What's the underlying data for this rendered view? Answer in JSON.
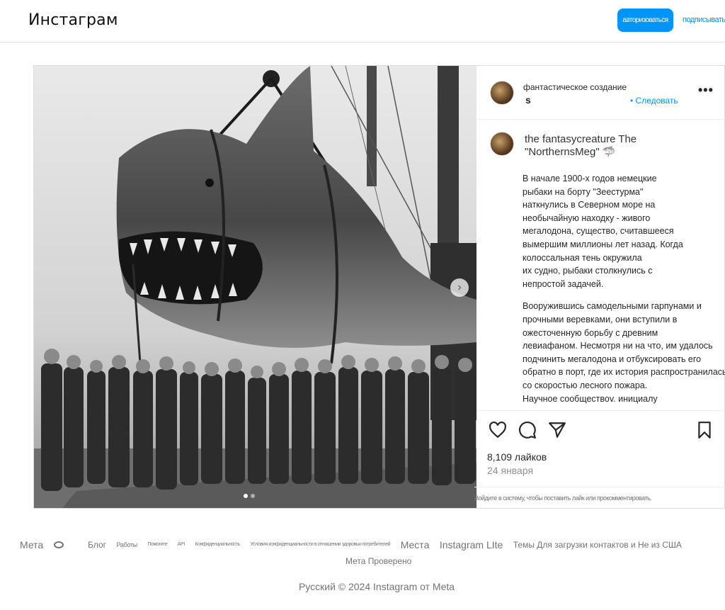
{
  "header": {
    "logo": "Инстаграм",
    "login_label": "авторизоваться",
    "signup_label": "подписывать"
  },
  "post": {
    "author_top": "фантастическое создание",
    "author_suffix": "s",
    "follow_label": "• Следовать",
    "more_icon": "•••",
    "next_icon": "›",
    "caption_author": "the fantasycreature The \"NorthernsMeg\" 🦈",
    "caption_p1": [
      "В начале 1900-х годов немецкие",
      "рыбаки на борту \"Зеестурма\"",
      "наткнулись в Северном море на",
      "необычайную находку - живого",
      "мегалодона, существо, считавшееся",
      "вымершим миллионы лет назад. Когда",
      "колоссальная тень окружила",
      "их судно, рыбаки столкнулись с",
      "непростой задачей."
    ],
    "caption_p2": [
      "Вооружившись самодельными гарпунами и",
      "прочными веревками, они вступили в",
      "ожесточенную борьбу с древним",
      "левиафаном. Несмотря ни на что, им удалось",
      "подчинить мегалодона и отбуксировать его",
      "обратно в порт, где их история распространилась",
      "со скоростью лесного пожара.",
      "Научное сообществоv. инициалу"
    ],
    "likes": "8,109 лайков",
    "date": "24 января",
    "login_note": "Войдите в систему, чтобы поставить лайк или прокомментировать.",
    "icons": [
      "heart-icon",
      "comment-icon",
      "share-icon",
      "bookmark-icon"
    ]
  },
  "footer": {
    "links": [
      "Мета",
      "Блог",
      "Работы",
      "Помогите",
      "API",
      "Конфиденциальность",
      "Условия конфиденциальности в отношении здоровья потребителей",
      "Места",
      "Instagram LIte",
      "Темы Для загрузки контактов и Не из США"
    ],
    "verified": "Мета Проверено",
    "copyright": "Русский © 2024 Instagram от Meta"
  },
  "colors": {
    "accent": "#0095f6",
    "border": "#dbdbdb",
    "muted": "#737373"
  }
}
